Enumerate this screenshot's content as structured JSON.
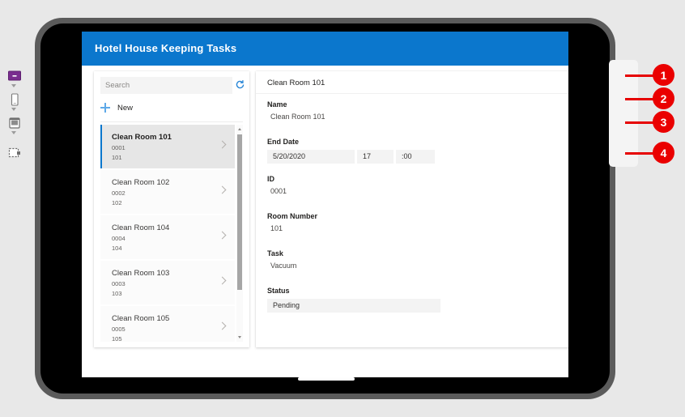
{
  "app": {
    "header_title": "Hotel House Keeping Tasks"
  },
  "sidebar": {
    "search": {
      "placeholder": "Search",
      "value": "",
      "refresh_icon": "refresh-icon"
    },
    "new_button": {
      "label": "New",
      "icon": "plus-icon"
    },
    "items": [
      {
        "title": "Clean Room 101",
        "id": "0001",
        "room": "101",
        "selected": true
      },
      {
        "title": "Clean Room 102",
        "id": "0002",
        "room": "102",
        "selected": false
      },
      {
        "title": "Clean Room 104",
        "id": "0004",
        "room": "104",
        "selected": false
      },
      {
        "title": "Clean Room 103",
        "id": "0003",
        "room": "103",
        "selected": false
      },
      {
        "title": "Clean Room 105",
        "id": "0005",
        "room": "105",
        "selected": false
      }
    ]
  },
  "detail": {
    "header_title": "Clean Room 101",
    "fields": {
      "name_label": "Name",
      "name_value": "Clean Room 101",
      "end_date_label": "End Date",
      "end_date_value": "5/20/2020",
      "end_hour_value": "17",
      "end_minute_value": ":00",
      "id_label": "ID",
      "id_value": "0001",
      "room_label": "Room Number",
      "room_value": "101",
      "task_label": "Task",
      "task_value": "Vacuum",
      "status_label": "Status",
      "status_value": "Pending"
    }
  },
  "callouts": [
    {
      "number": "1",
      "icon": "monitor-icon"
    },
    {
      "number": "2",
      "icon": "phone-icon"
    },
    {
      "number": "3",
      "icon": "tablet-icon"
    },
    {
      "number": "4",
      "icon": "resize-handle-icon"
    }
  ],
  "colors": {
    "header_blue": "#0b77cd",
    "accent_blue": "#0b77cd",
    "badge_red": "#ea0000",
    "monitor_purple": "#7a2d8f"
  }
}
